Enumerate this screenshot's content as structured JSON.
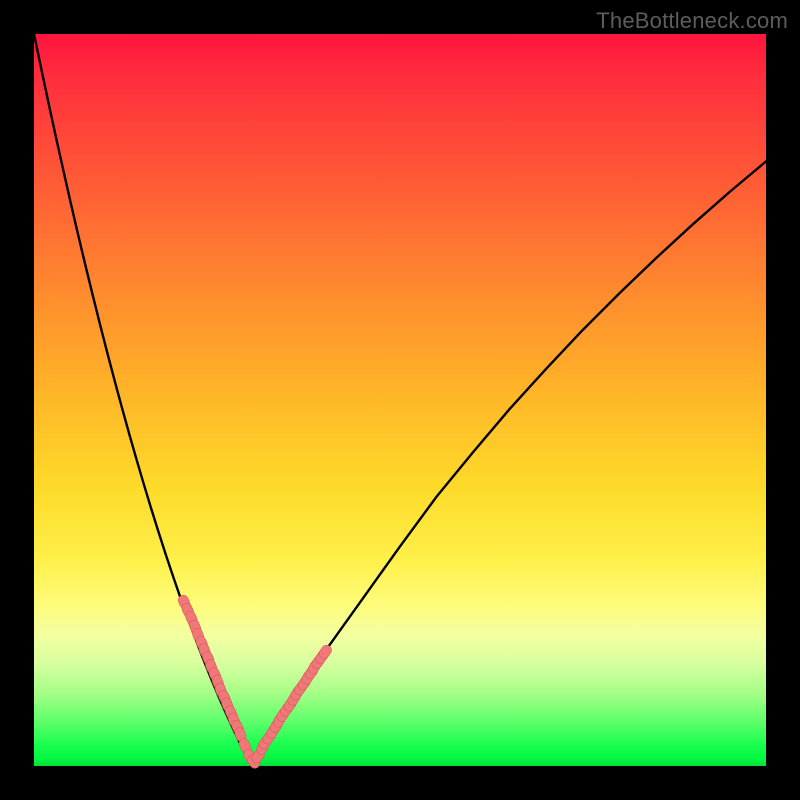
{
  "watermark": "TheBottleneck.com",
  "colors": {
    "background": "#000000",
    "gradient_top": "#ff153d",
    "gradient_bottom": "#02e03c",
    "curve": "#000000",
    "marker_fill": "#f07878",
    "marker_stroke": "#d85a5a"
  },
  "chart_data": {
    "type": "line",
    "title": "",
    "xlabel": "",
    "ylabel": "",
    "xlim": [
      0,
      100
    ],
    "ylim": [
      0,
      100
    ],
    "x": [
      0,
      1,
      2,
      3,
      4,
      5,
      6,
      7,
      8,
      9,
      10,
      11,
      12,
      13,
      14,
      15,
      16,
      17,
      18,
      19,
      20,
      21,
      22,
      23,
      24,
      25,
      26,
      27,
      28,
      29,
      30,
      31,
      32,
      33,
      34,
      35,
      36,
      37,
      38,
      39,
      40,
      45,
      50,
      55,
      60,
      65,
      70,
      75,
      80,
      85,
      90,
      95,
      100
    ],
    "y": [
      100,
      95.2,
      90.5,
      85.9,
      81.4,
      77.0,
      72.7,
      68.5,
      64.4,
      60.4,
      56.5,
      52.7,
      49.0,
      45.4,
      41.9,
      38.5,
      35.2,
      32.0,
      28.9,
      25.9,
      23.0,
      20.2,
      17.5,
      14.9,
      12.4,
      10.0,
      7.7,
      5.5,
      3.4,
      1.4,
      0.7,
      1.9,
      3.6,
      5.2,
      6.8,
      8.4,
      10.0,
      11.5,
      13.0,
      14.5,
      16.0,
      23.0,
      30.0,
      36.8,
      42.9,
      48.8,
      54.3,
      59.6,
      64.6,
      69.4,
      74.0,
      78.4,
      82.6
    ],
    "series": [
      {
        "name": "marker-cluster-left",
        "x": [
          20.5,
          21.0,
          21.5,
          22.0,
          22.4,
          22.9,
          23.3,
          23.8,
          24.2,
          24.7,
          25.1,
          25.5,
          26.0,
          26.4,
          26.9,
          27.3,
          27.8,
          28.2
        ],
        "y": [
          22.4,
          21.3,
          20.2,
          19.0,
          17.9,
          16.8,
          15.8,
          14.7,
          13.6,
          12.5,
          11.5,
          10.4,
          9.4,
          8.4,
          7.3,
          6.3,
          5.3,
          4.3
        ]
      },
      {
        "name": "marker-cluster-bottom",
        "x": [
          28.8,
          29.4,
          30.0,
          30.6,
          31.2
        ],
        "y": [
          2.8,
          1.4,
          0.6,
          1.3,
          2.5
        ]
      },
      {
        "name": "marker-cluster-right",
        "x": [
          31.6,
          32.1,
          32.6,
          33.1,
          33.5,
          34.0,
          34.5,
          35.0,
          35.5,
          35.9,
          36.4,
          36.9,
          37.4,
          37.9,
          38.3,
          38.8,
          39.3,
          39.8
        ],
        "y": [
          3.2,
          3.9,
          4.7,
          5.5,
          6.2,
          7.0,
          7.7,
          8.4,
          9.2,
          9.9,
          10.6,
          11.3,
          12.1,
          12.8,
          13.5,
          14.2,
          14.9,
          15.6
        ]
      }
    ],
    "grid": false,
    "legend": false
  }
}
